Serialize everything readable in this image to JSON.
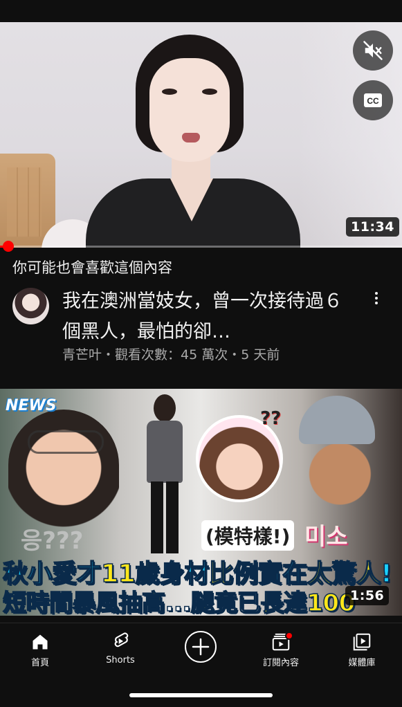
{
  "player": {
    "duration": "11:34",
    "progress_fraction": 0.01,
    "mute_icon": "muted-speaker-icon",
    "cc_label": "CC"
  },
  "recommendations": {
    "section_title": "你可能也會喜歡這個內容"
  },
  "video": {
    "title": "我在澳洲當妓女，曾一次接待過６個黑人，最怕的卻…",
    "channel": "青芒叶",
    "meta": "青芒叶・觀看次數：45 萬次・5 天前",
    "more_icon": "more-vertical-icon"
  },
  "thumbnail2": {
    "badge_news": "NEWS",
    "bubble_text": "응???",
    "question_marks": "??",
    "tag": "(模特樣!)",
    "korean": "미소",
    "caption_line1_a": "秋小愛才",
    "caption_line1_b": "11歲",
    "caption_line1_c": "身材",
    "caption_line1_d": "比例",
    "caption_line1_e": "實在",
    "caption_line1_f": "太驚人",
    "caption_line1_g": "!",
    "caption_line2_a": "短時間",
    "caption_line2_b": "暴風抽高",
    "caption_line2_c": "...",
    "caption_line2_d": "腿",
    "caption_line2_e": "竟已",
    "caption_line2_f": "長達",
    "caption_line2_g": "100",
    "duration": "1:56"
  },
  "nav": {
    "home": "首頁",
    "shorts": "Shorts",
    "subscriptions": "訂閱內容",
    "library": "媒體庫"
  },
  "colors": {
    "background": "#0f0f0f",
    "accent_red": "#ff0000",
    "meta_gray": "#aaaaaa"
  }
}
